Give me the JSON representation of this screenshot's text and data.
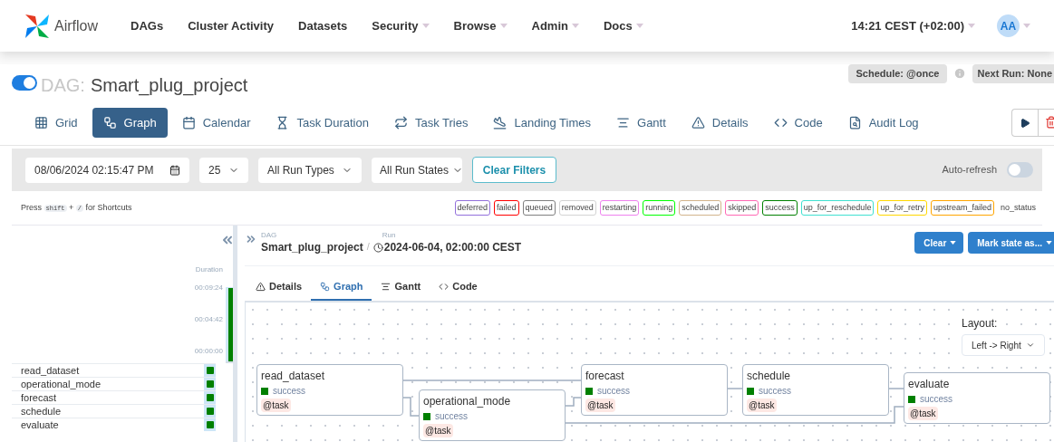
{
  "nav": {
    "brand": "Airflow",
    "items": [
      {
        "label": "DAGs",
        "dropdown": false
      },
      {
        "label": "Cluster Activity",
        "dropdown": false
      },
      {
        "label": "Datasets",
        "dropdown": false
      },
      {
        "label": "Security",
        "dropdown": true
      },
      {
        "label": "Browse",
        "dropdown": true
      },
      {
        "label": "Admin",
        "dropdown": true
      },
      {
        "label": "Docs",
        "dropdown": true
      }
    ],
    "time": "14:21 CEST (+02:00)",
    "user": "AA"
  },
  "dag": {
    "on": true,
    "prefix": "DAG:",
    "name": "Smart_plug_project",
    "schedule": "Schedule: @once",
    "next_run": "Next Run: None"
  },
  "view_tabs": [
    {
      "label": "Grid",
      "selected": false
    },
    {
      "label": "Graph",
      "selected": true
    },
    {
      "label": "Calendar",
      "selected": false
    },
    {
      "label": "Task Duration",
      "selected": false
    },
    {
      "label": "Task Tries",
      "selected": false
    },
    {
      "label": "Landing Times",
      "selected": false
    },
    {
      "label": "Gantt",
      "selected": false
    },
    {
      "label": "Details",
      "selected": false
    },
    {
      "label": "Code",
      "selected": false
    },
    {
      "label": "Audit Log",
      "selected": false
    }
  ],
  "filters": {
    "date": "08/06/2024 02:15:47 PM",
    "limit": "25",
    "run_types": "All Run Types",
    "run_states": "All Run States",
    "clear": "Clear Filters",
    "auto_refresh": {
      "label": "Auto-refresh",
      "on": false
    }
  },
  "shortcuts": {
    "press": "Press",
    "key1": "shift",
    "plus": "+",
    "key2": "/",
    "tail": "for Shortcuts"
  },
  "legend": [
    {
      "label": "deferred",
      "color": "#9370db"
    },
    {
      "label": "failed",
      "color": "#ff0000"
    },
    {
      "label": "queued",
      "color": "#808080"
    },
    {
      "label": "removed",
      "color": "#d3d3d3"
    },
    {
      "label": "restarting",
      "color": "#ee82ee"
    },
    {
      "label": "running",
      "color": "#00ff00"
    },
    {
      "label": "scheduled",
      "color": "#d2b48c"
    },
    {
      "label": "skipped",
      "color": "#ff69b4"
    },
    {
      "label": "success",
      "color": "#008000"
    },
    {
      "label": "up_for_reschedule",
      "color": "#40e0d0"
    },
    {
      "label": "up_for_retry",
      "color": "#ffd700"
    },
    {
      "label": "upstream_failed",
      "color": "#ffa500"
    },
    {
      "label": "no_status"
    }
  ],
  "grid": {
    "duration_label": "Duration",
    "ticks": [
      "00:09:24",
      "00:04:42",
      "00:00:00"
    ],
    "run": {
      "color": "#008000"
    },
    "tasks": [
      {
        "name": "read_dataset",
        "color": "#008000"
      },
      {
        "name": "operational_mode",
        "color": "#008000"
      },
      {
        "name": "forecast",
        "color": "#008000"
      },
      {
        "name": "schedule",
        "color": "#008000"
      },
      {
        "name": "evaluate",
        "color": "#008000"
      }
    ]
  },
  "details": {
    "dag_label": "DAG",
    "dag_name": "Smart_plug_project",
    "separator": "/",
    "run_label": "Run",
    "run": "2024-06-04, 02:00:00 CEST",
    "buttons": [
      "Clear",
      "Mark state as..."
    ],
    "tabs": [
      {
        "label": "Details",
        "selected": false
      },
      {
        "label": "Graph",
        "selected": true
      },
      {
        "label": "Gantt",
        "selected": false
      },
      {
        "label": "Code",
        "selected": false
      }
    ]
  },
  "graph": {
    "layout_label": "Layout:",
    "layout": "Left -> Right",
    "nodes": [
      {
        "name": "read_dataset",
        "state": "success",
        "color": "#008000",
        "tag": "@task"
      },
      {
        "name": "operational_mode",
        "state": "success",
        "color": "#008000",
        "tag": "@task"
      },
      {
        "name": "forecast",
        "state": "success",
        "color": "#008000",
        "tag": "@task"
      },
      {
        "name": "schedule",
        "state": "success",
        "color": "#008000",
        "tag": "@task"
      },
      {
        "name": "evaluate",
        "state": "success",
        "color": "#008000",
        "tag": "@task"
      }
    ]
  }
}
